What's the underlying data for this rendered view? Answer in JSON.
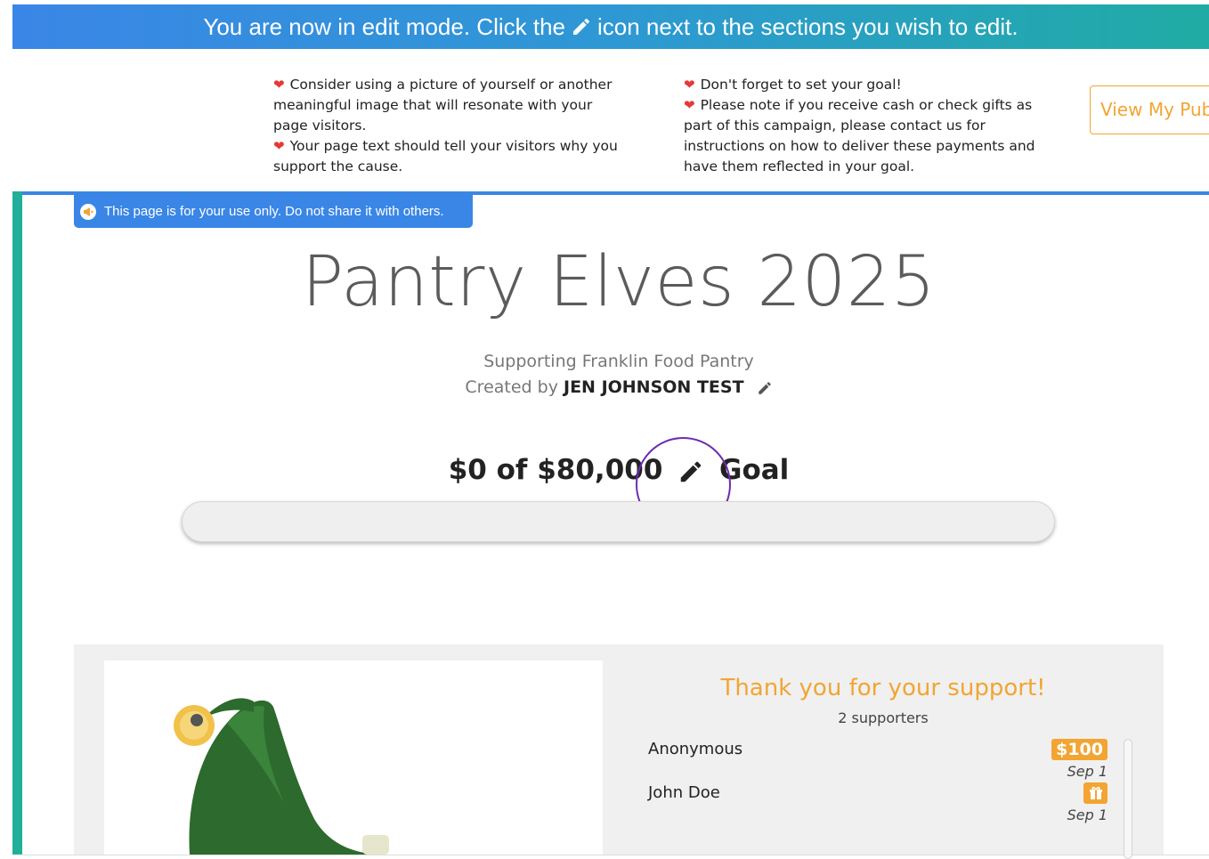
{
  "banner": {
    "text_before": "You are now in edit mode. Click the",
    "text_after": "icon next to the sections you wish to edit."
  },
  "tips": {
    "left": [
      "Consider using a picture of yourself or another meaningful image that will resonate with your page visitors.",
      "Your page text should tell your visitors why you support the cause."
    ],
    "right": [
      "Don't forget to set your goal!",
      "Please note if you receive cash or check gifts as part of this campaign, please contact us for instructions on how to deliver these payments and have them reflected in your goal."
    ]
  },
  "view_public_button": "View My Pub",
  "private_notice": "This page is for your use only. Do not share it with others.",
  "campaign": {
    "title": "Pantry Elves 2025",
    "subtitle": "Supporting Franklin Food Pantry",
    "created_by_prefix": "Created by",
    "creator_name": "JEN JOHNSON TEST"
  },
  "goal": {
    "raised": "$0",
    "of_label": "of",
    "target": "$80,000",
    "suffix": "Goal",
    "progress_fraction": 0
  },
  "supporters": {
    "title": "Thank you for your support!",
    "count_label": "2 supporters",
    "list": [
      {
        "name": "Anonymous",
        "amount": "$100",
        "date": "Sep 1",
        "badge": "amount"
      },
      {
        "name": "John Doe",
        "amount": "",
        "date": "Sep 1",
        "badge": "gift-icon"
      }
    ]
  },
  "colors": {
    "accent_orange": "#f2a532",
    "banner_blue": "#3a86e6",
    "banner_teal": "#20aca4",
    "heart_red": "#e53935",
    "highlight_purple": "#6d2bb1"
  }
}
